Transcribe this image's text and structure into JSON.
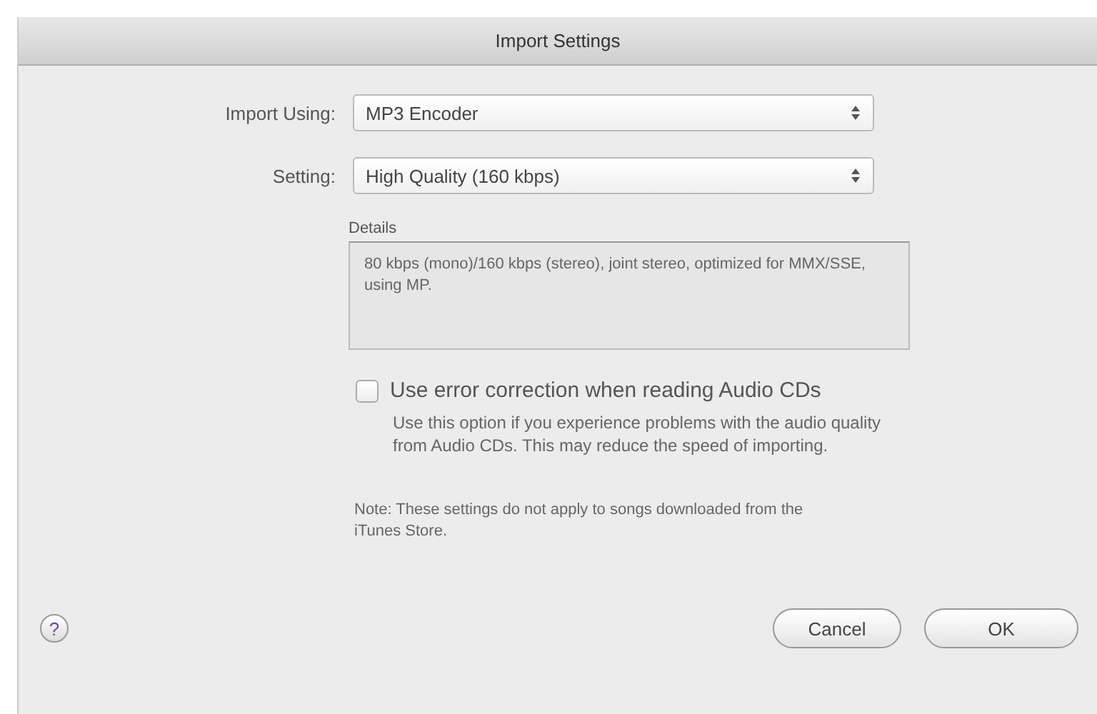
{
  "window": {
    "title": "Import Settings"
  },
  "fields": [
    {
      "label": "Import Using:",
      "value": "MP3 Encoder"
    },
    {
      "label": "Setting:",
      "value": "High Quality (160 kbps)"
    }
  ],
  "details": {
    "label": "Details",
    "text": "80 kbps (mono)/160 kbps (stereo), joint stereo, optimized for MMX/SSE, using MP."
  },
  "error_correction": {
    "label": "Use error correction when reading Audio CDs",
    "checked": false,
    "description": "Use this option if you experience problems with the audio quality from Audio CDs. This may reduce the speed of importing."
  },
  "note": "Note: These settings do not apply to songs downloaded from the iTunes Store.",
  "help": "?",
  "buttons": [
    {
      "label": "Cancel",
      "default": false
    },
    {
      "label": "OK",
      "default": false
    }
  ]
}
